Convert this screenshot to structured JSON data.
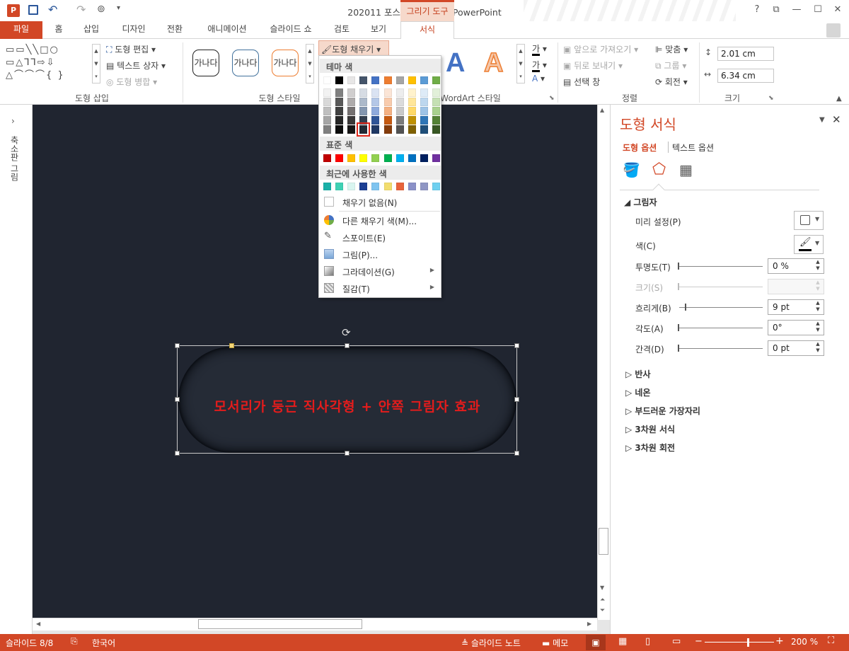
{
  "window": {
    "title": "202011 포스팅용 완성본 - PowerPoint",
    "contextual_tab": "그리기 도구",
    "help": "?",
    "restore": "⧉",
    "minimize": "—",
    "maximize": "☐",
    "close": "✕"
  },
  "tabs": {
    "file": "파일",
    "home": "홈",
    "insert": "삽입",
    "design": "디자인",
    "transitions": "전환",
    "animations": "애니메이션",
    "slideshow": "슬라이드 쇼",
    "review": "검토",
    "view": "보기",
    "format": "서식"
  },
  "ribbon": {
    "insert_shapes": {
      "label": "도형 삽입",
      "edit_shape": "도형 편집",
      "text_box": "텍스트 상자",
      "merge_shapes": "도형 병합"
    },
    "shape_styles": {
      "label": "도형 스타일",
      "samples": [
        "가나다",
        "가나다",
        "가나다"
      ],
      "fill": "도형 채우기"
    },
    "wordart": {
      "label": "WordArt 스타일",
      "sample": "A",
      "text_fill_glyph": "가"
    },
    "arrange": {
      "label": "정렬",
      "bring_forward": "앞으로 가져오기",
      "send_backward": "뒤로 보내기",
      "selection_pane": "선택 창",
      "align": "맞춤",
      "group": "그룹",
      "rotate": "회전"
    },
    "size": {
      "label": "크기",
      "height": "2.01 cm",
      "width": "6.34 cm"
    }
  },
  "fill_dropdown": {
    "theme_header": "테마 색",
    "standard_header": "표준 색",
    "recent_header": "최근에 사용한 색",
    "theme_top": [
      "#ffffff",
      "#000000",
      "#e7e6e6",
      "#44546a",
      "#4472c4",
      "#ed7d31",
      "#a5a5a5",
      "#ffc000",
      "#5b9bd5",
      "#70ad47"
    ],
    "theme_shades": [
      [
        "#f2f2f2",
        "#d9d9d9",
        "#bfbfbf",
        "#a6a6a6",
        "#808080"
      ],
      [
        "#808080",
        "#595959",
        "#404040",
        "#262626",
        "#0d0d0d"
      ],
      [
        "#d0cece",
        "#aeabab",
        "#757171",
        "#3a3838",
        "#171616"
      ],
      [
        "#d6dce4",
        "#acb9ca",
        "#8497b0",
        "#333f4f",
        "#222a35"
      ],
      [
        "#dae3f3",
        "#b4c7e7",
        "#8faadc",
        "#2f5597",
        "#1f3864"
      ],
      [
        "#fbe5d6",
        "#f8cbad",
        "#f4b183",
        "#c55a11",
        "#843c0c"
      ],
      [
        "#ededed",
        "#dbdbdb",
        "#c9c9c9",
        "#7b7b7b",
        "#525252"
      ],
      [
        "#fff2cc",
        "#ffe699",
        "#ffd966",
        "#bf9000",
        "#7f6000"
      ],
      [
        "#deebf7",
        "#bdd7ee",
        "#9dc3e6",
        "#2e75b6",
        "#1f4e79"
      ],
      [
        "#e2f0d9",
        "#c5e0b4",
        "#a9d18e",
        "#548235",
        "#385723"
      ]
    ],
    "standard": [
      "#c00000",
      "#ff0000",
      "#ffc000",
      "#ffff00",
      "#92d050",
      "#00b050",
      "#00b0f0",
      "#0070c0",
      "#002060",
      "#7030a0"
    ],
    "recent": [
      "#1ab0a8",
      "#3fd1b4",
      "#d9f5f0",
      "#1c3f94",
      "#7fc4f0",
      "#f2dd6e",
      "#e8643c",
      "#8b91c8",
      "#8f96c4",
      "#6fd0f0"
    ],
    "no_fill": "채우기 없음(N)",
    "more_colors": "다른 채우기 색(M)...",
    "eyedropper": "스포이트(E)",
    "picture": "그림(P)...",
    "gradient": "그라데이션(G)",
    "texture": "질감(T)"
  },
  "slide": {
    "text": "모서리가 둥근 직사각형 + 안쪽 그림자 효과",
    "thumb_label": "축소판 그림"
  },
  "format_pane": {
    "title": "도형 서식",
    "tab_shape": "도형 옵션",
    "tab_text": "텍스트 옵션",
    "shadow": "그림자",
    "preset": "미리 설정(P)",
    "color": "색(C)",
    "transparency": "투명도(T)",
    "transparency_val": "0 %",
    "size": "크기(S)",
    "blur": "흐리게(B)",
    "blur_val": "9 pt",
    "angle": "각도(A)",
    "angle_val": "0°",
    "distance": "간격(D)",
    "distance_val": "0 pt",
    "sections": [
      "반사",
      "네온",
      "부드러운 가장자리",
      "3차원 서식",
      "3차원 회전"
    ]
  },
  "status": {
    "slide": "슬라이드 8/8",
    "lang": "한국어",
    "notes": "슬라이드 노트",
    "comments": "메모",
    "zoom": "200 %"
  }
}
